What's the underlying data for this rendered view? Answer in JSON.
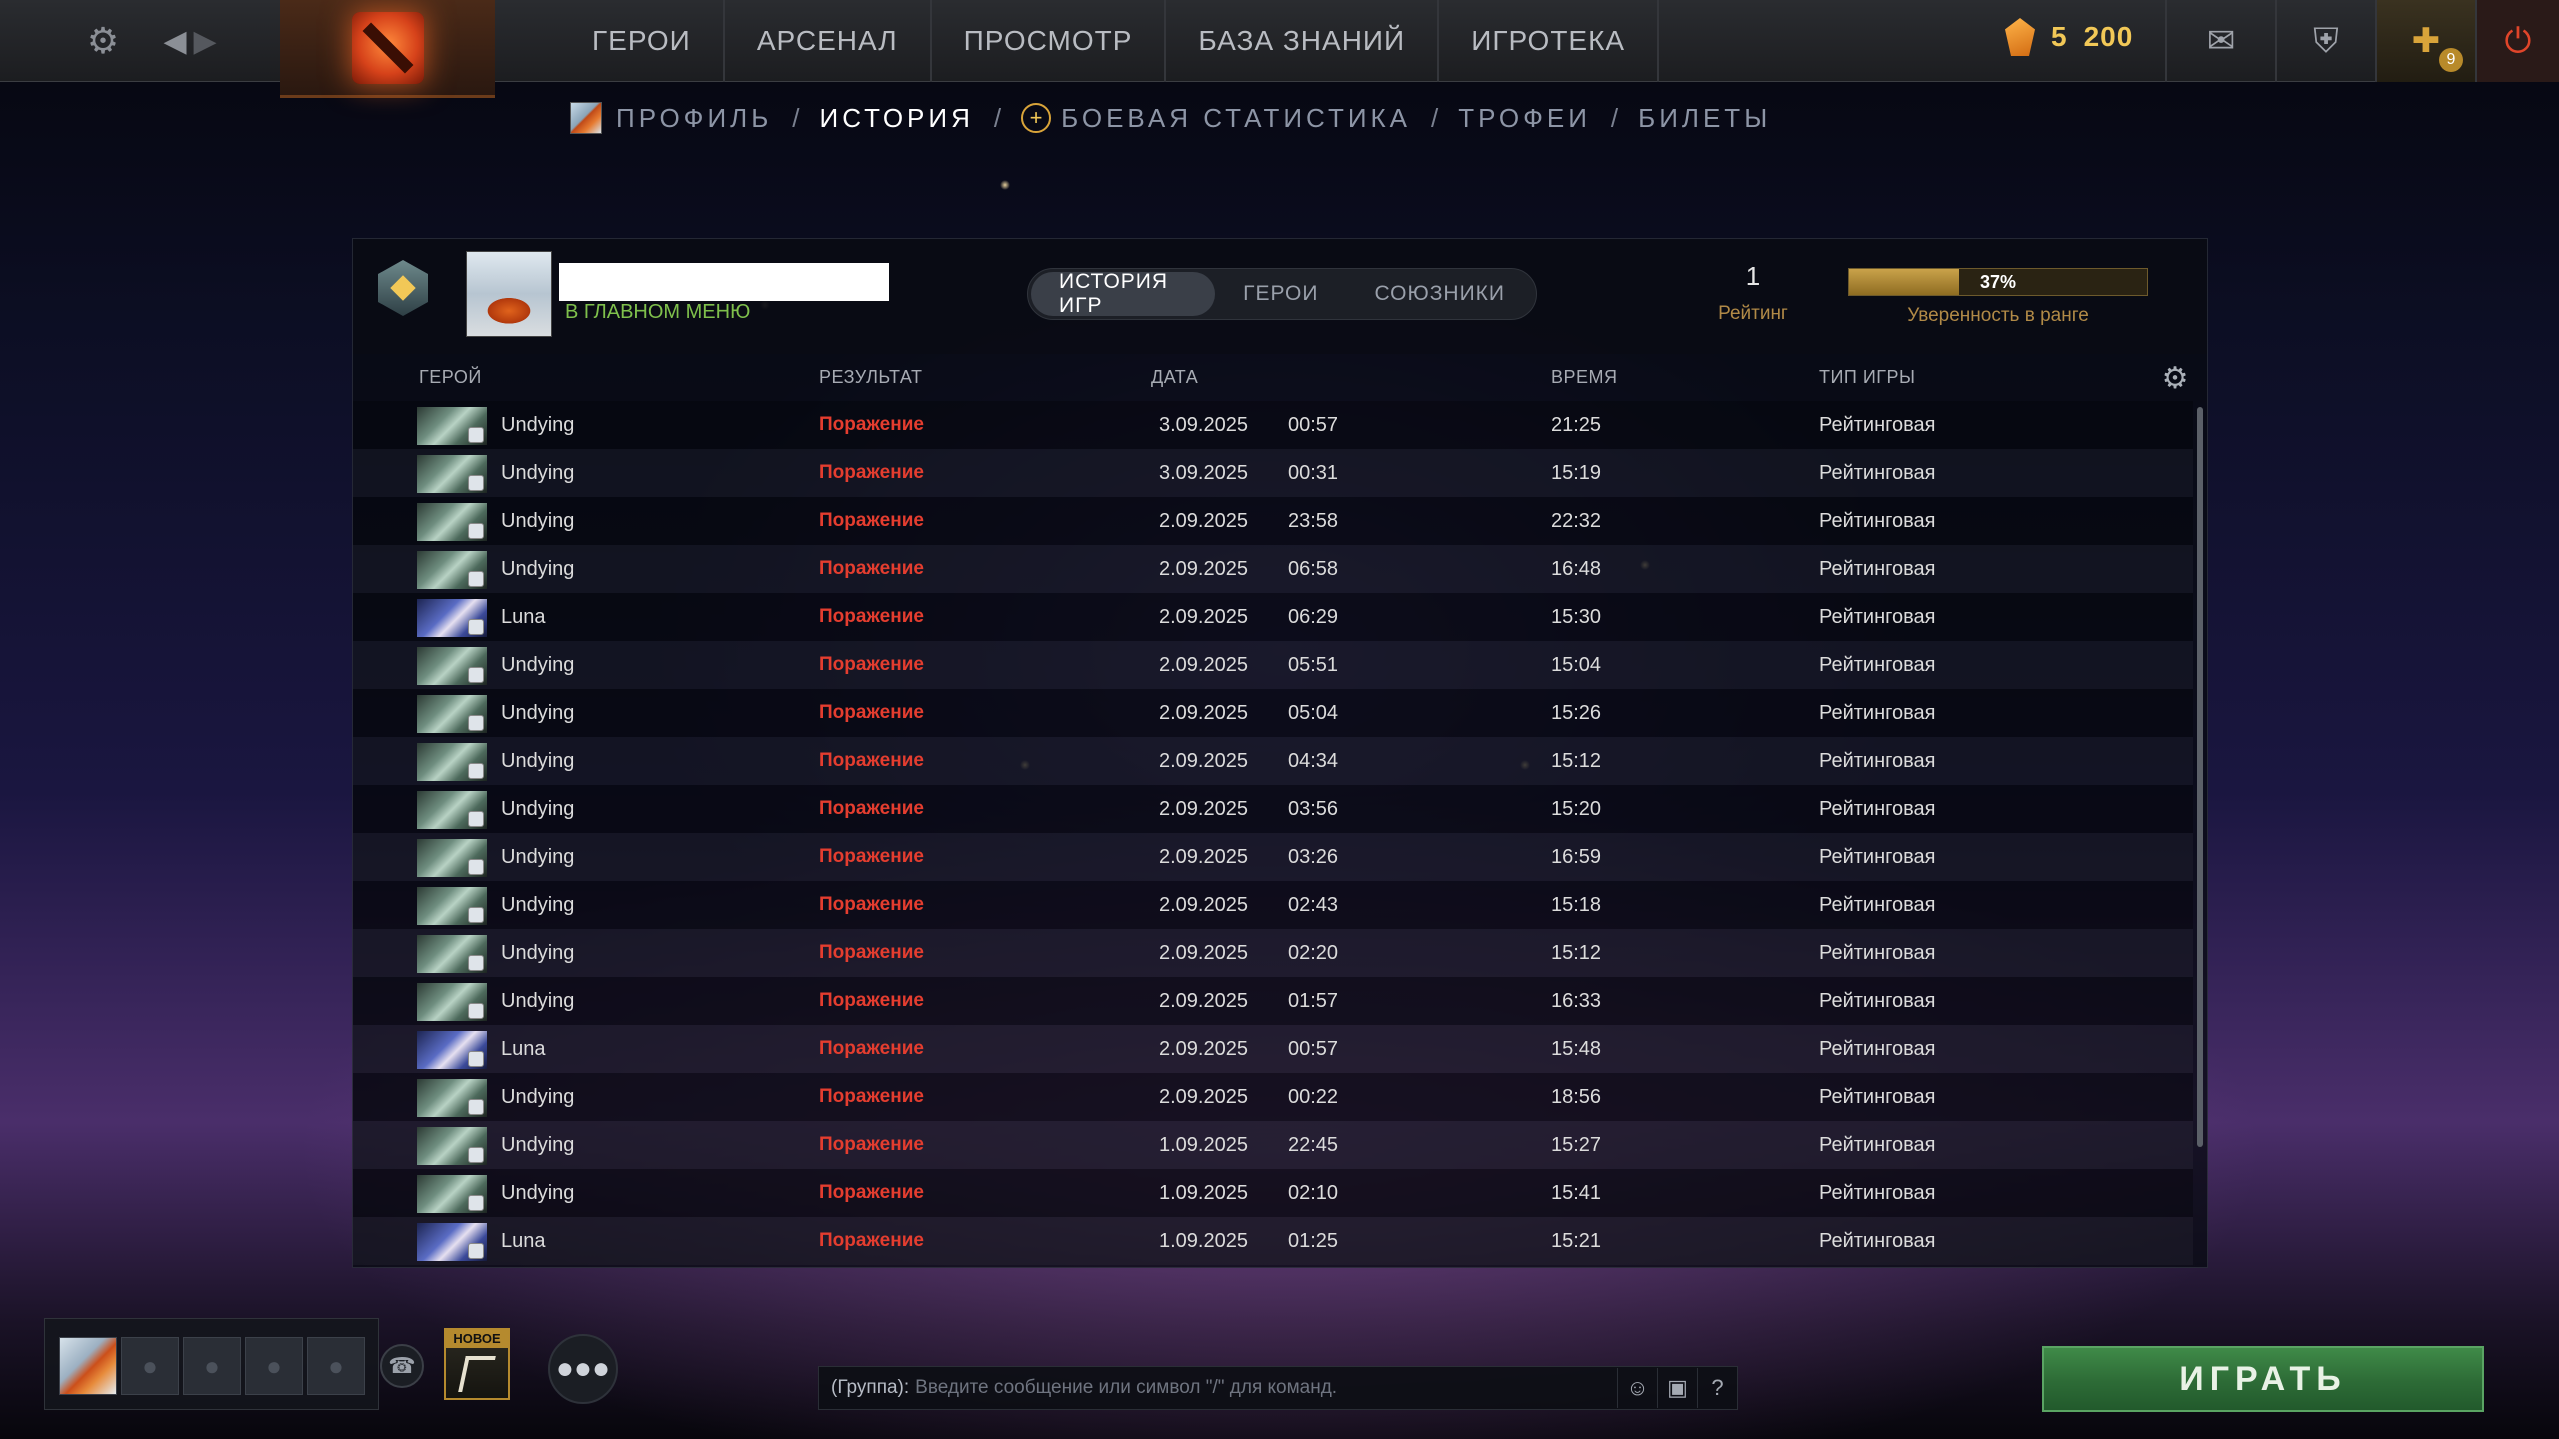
{
  "topbar": {
    "nav": [
      "ГЕРОИ",
      "АРСЕНАЛ",
      "ПРОСМОТР",
      "БАЗА ЗНАНИЙ",
      "ИГРОТЕКА"
    ],
    "currency": {
      "shards": "5",
      "amount": "200"
    },
    "plus_badge": "9",
    "icons": [
      "gear-icon",
      "back-icon",
      "forward-icon",
      "dota-logo",
      "mail-icon",
      "armory-icon",
      "dota-plus-icon",
      "power-icon"
    ]
  },
  "subnav": {
    "items": [
      "ПРОФИЛЬ",
      "ИСТОРИЯ",
      "БОЕВАЯ СТАТИСТИКА",
      "ТРОФЕИ",
      "БИЛЕТЫ"
    ],
    "active": "ИСТОРИЯ",
    "separator": "/"
  },
  "profile": {
    "status": "В ГЛАВНОМ МЕНЮ",
    "rating": "1",
    "rating_label": "Рейтинг",
    "confidence": 37,
    "confidence_text": "37%",
    "confidence_label": "Уверенность в ранге"
  },
  "tabs": [
    "ИСТОРИЯ ИГР",
    "ГЕРОИ",
    "СОЮЗНИКИ"
  ],
  "columns": {
    "hero": "ГЕРОЙ",
    "result": "РЕЗУЛЬТАТ",
    "date": "ДАТА",
    "duration": "ВРЕМЯ",
    "mode": "ТИП ИГРЫ"
  },
  "matches": [
    {
      "hero": "Undying",
      "result": "Поражение",
      "date": "3.09.2025",
      "time": "00:57",
      "duration": "21:25",
      "mode": "Рейтинговая"
    },
    {
      "hero": "Undying",
      "result": "Поражение",
      "date": "3.09.2025",
      "time": "00:31",
      "duration": "15:19",
      "mode": "Рейтинговая"
    },
    {
      "hero": "Undying",
      "result": "Поражение",
      "date": "2.09.2025",
      "time": "23:58",
      "duration": "22:32",
      "mode": "Рейтинговая"
    },
    {
      "hero": "Undying",
      "result": "Поражение",
      "date": "2.09.2025",
      "time": "06:58",
      "duration": "16:48",
      "mode": "Рейтинговая"
    },
    {
      "hero": "Luna",
      "result": "Поражение",
      "date": "2.09.2025",
      "time": "06:29",
      "duration": "15:30",
      "mode": "Рейтинговая"
    },
    {
      "hero": "Undying",
      "result": "Поражение",
      "date": "2.09.2025",
      "time": "05:51",
      "duration": "15:04",
      "mode": "Рейтинговая"
    },
    {
      "hero": "Undying",
      "result": "Поражение",
      "date": "2.09.2025",
      "time": "05:04",
      "duration": "15:26",
      "mode": "Рейтинговая"
    },
    {
      "hero": "Undying",
      "result": "Поражение",
      "date": "2.09.2025",
      "time": "04:34",
      "duration": "15:12",
      "mode": "Рейтинговая"
    },
    {
      "hero": "Undying",
      "result": "Поражение",
      "date": "2.09.2025",
      "time": "03:56",
      "duration": "15:20",
      "mode": "Рейтинговая"
    },
    {
      "hero": "Undying",
      "result": "Поражение",
      "date": "2.09.2025",
      "time": "03:26",
      "duration": "16:59",
      "mode": "Рейтинговая"
    },
    {
      "hero": "Undying",
      "result": "Поражение",
      "date": "2.09.2025",
      "time": "02:43",
      "duration": "15:18",
      "mode": "Рейтинговая"
    },
    {
      "hero": "Undying",
      "result": "Поражение",
      "date": "2.09.2025",
      "time": "02:20",
      "duration": "15:12",
      "mode": "Рейтинговая"
    },
    {
      "hero": "Undying",
      "result": "Поражение",
      "date": "2.09.2025",
      "time": "01:57",
      "duration": "16:33",
      "mode": "Рейтинговая"
    },
    {
      "hero": "Luna",
      "result": "Поражение",
      "date": "2.09.2025",
      "time": "00:57",
      "duration": "15:48",
      "mode": "Рейтинговая"
    },
    {
      "hero": "Undying",
      "result": "Поражение",
      "date": "2.09.2025",
      "time": "00:22",
      "duration": "18:56",
      "mode": "Рейтинговая"
    },
    {
      "hero": "Undying",
      "result": "Поражение",
      "date": "1.09.2025",
      "time": "22:45",
      "duration": "15:27",
      "mode": "Рейтинговая"
    },
    {
      "hero": "Undying",
      "result": "Поражение",
      "date": "1.09.2025",
      "time": "02:10",
      "duration": "15:41",
      "mode": "Рейтинговая"
    },
    {
      "hero": "Luna",
      "result": "Поражение",
      "date": "1.09.2025",
      "time": "01:25",
      "duration": "15:21",
      "mode": "Рейтинговая"
    }
  ],
  "bottom": {
    "plus_new": "НОВОЕ",
    "chat_channel": "(Группа):",
    "chat_placeholder": "Введите сообщение или символ \"/\" для команд.",
    "help": "?",
    "play": "ИГРАТЬ"
  },
  "colors": {
    "loss": "#e43d2f",
    "status": "#7fc04c",
    "accent_gold": "#f2c857",
    "play_green": "#2d6b36"
  }
}
